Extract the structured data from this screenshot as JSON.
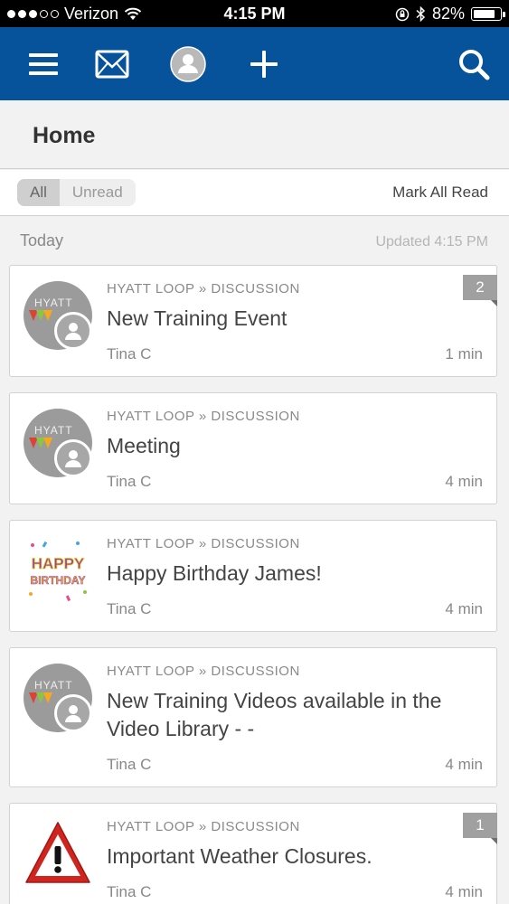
{
  "status_bar": {
    "carrier": "Verizon",
    "time": "4:15 PM",
    "battery": "82%",
    "battery_level": 0.82
  },
  "nav": {
    "icons": [
      "menu-icon",
      "mail-icon",
      "profile-icon",
      "add-icon",
      "search-icon"
    ],
    "brand_color": "#06539c"
  },
  "page": {
    "title": "Home"
  },
  "filter": {
    "options": [
      "All",
      "Unread"
    ],
    "selected": "All",
    "mark_all_read": "Mark All Read"
  },
  "section": {
    "label": "Today",
    "updated": "Updated 4:15 PM"
  },
  "feed": [
    {
      "crumb": "HYATT LOOP » DISCUSSION",
      "title": "New Training Event",
      "author": "Tina C",
      "time": "1 min",
      "count": "2",
      "avatar": "hyatt-logo"
    },
    {
      "crumb": "HYATT LOOP » DISCUSSION",
      "title": "Meeting",
      "author": "Tina C",
      "time": "4 min",
      "avatar": "hyatt-logo"
    },
    {
      "crumb": "HYATT LOOP » DISCUSSION",
      "title": "Happy Birthday James!",
      "author": "Tina C",
      "time": "4 min",
      "avatar": "happy-birthday-image",
      "thumb_text_1": "HAPPY",
      "thumb_text_2": "BIRTHDAY"
    },
    {
      "crumb": "HYATT LOOP » DISCUSSION",
      "title": "New Training Videos available in the Video Library - -",
      "author": "Tina C",
      "time": "4 min",
      "avatar": "hyatt-logo"
    },
    {
      "crumb": "HYATT LOOP » DISCUSSION",
      "title": "Important Weather Closures.",
      "author": "Tina C",
      "time": "4 min",
      "count": "1",
      "avatar": "warning-icon"
    }
  ],
  "logo_text": "HYATT"
}
